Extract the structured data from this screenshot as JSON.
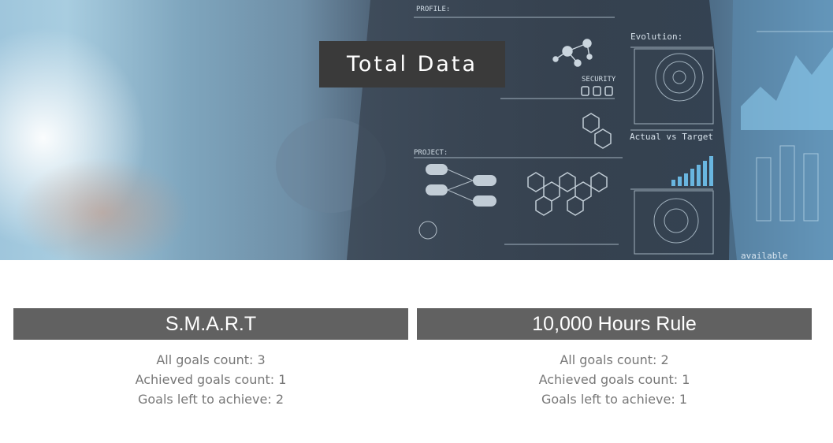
{
  "hero": {
    "title": "Total Data",
    "hud_labels": {
      "profile": "PROFILE:",
      "security": "SECURITY",
      "evolution": "Evolution:",
      "actual_vs_target": "Actual vs Target",
      "project": "PROJECT:",
      "available": "available"
    }
  },
  "cards": [
    {
      "title": "S.M.A.R.T",
      "all_goals": "All goals count: 3",
      "achieved": "Achieved goals count: 1",
      "left": "Goals left to achieve: 2"
    },
    {
      "title": "10,000 Hours Rule",
      "all_goals": "All goals count: 2",
      "achieved": "Achieved goals count: 1",
      "left": "Goals left to achieve: 1"
    }
  ]
}
